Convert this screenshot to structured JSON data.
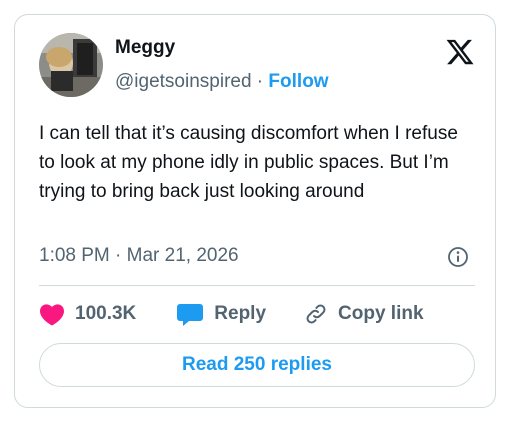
{
  "tweet": {
    "author_name": "Meggy",
    "handle": "@igetsoinspired",
    "separator": " · ",
    "follow_label": "Follow",
    "text": "I can tell that it’s causing discomfort when I refuse to look at my phone idly in public spaces. But I’m trying to bring back just looking around",
    "timestamp": "1:08 PM · Mar 21, 2026"
  },
  "actions": {
    "like_count": "100.3K",
    "reply_label": "Reply",
    "copy_link_label": "Copy link"
  },
  "read_replies_label": "Read 250 replies",
  "colors": {
    "accent": "#1d9bf0",
    "like": "#f91880",
    "text": "#0f1419",
    "muted": "#536471",
    "border": "#cfd9de"
  },
  "icons": [
    "x-logo-icon",
    "info-icon",
    "heart-icon",
    "reply-bubble-icon",
    "link-icon"
  ]
}
